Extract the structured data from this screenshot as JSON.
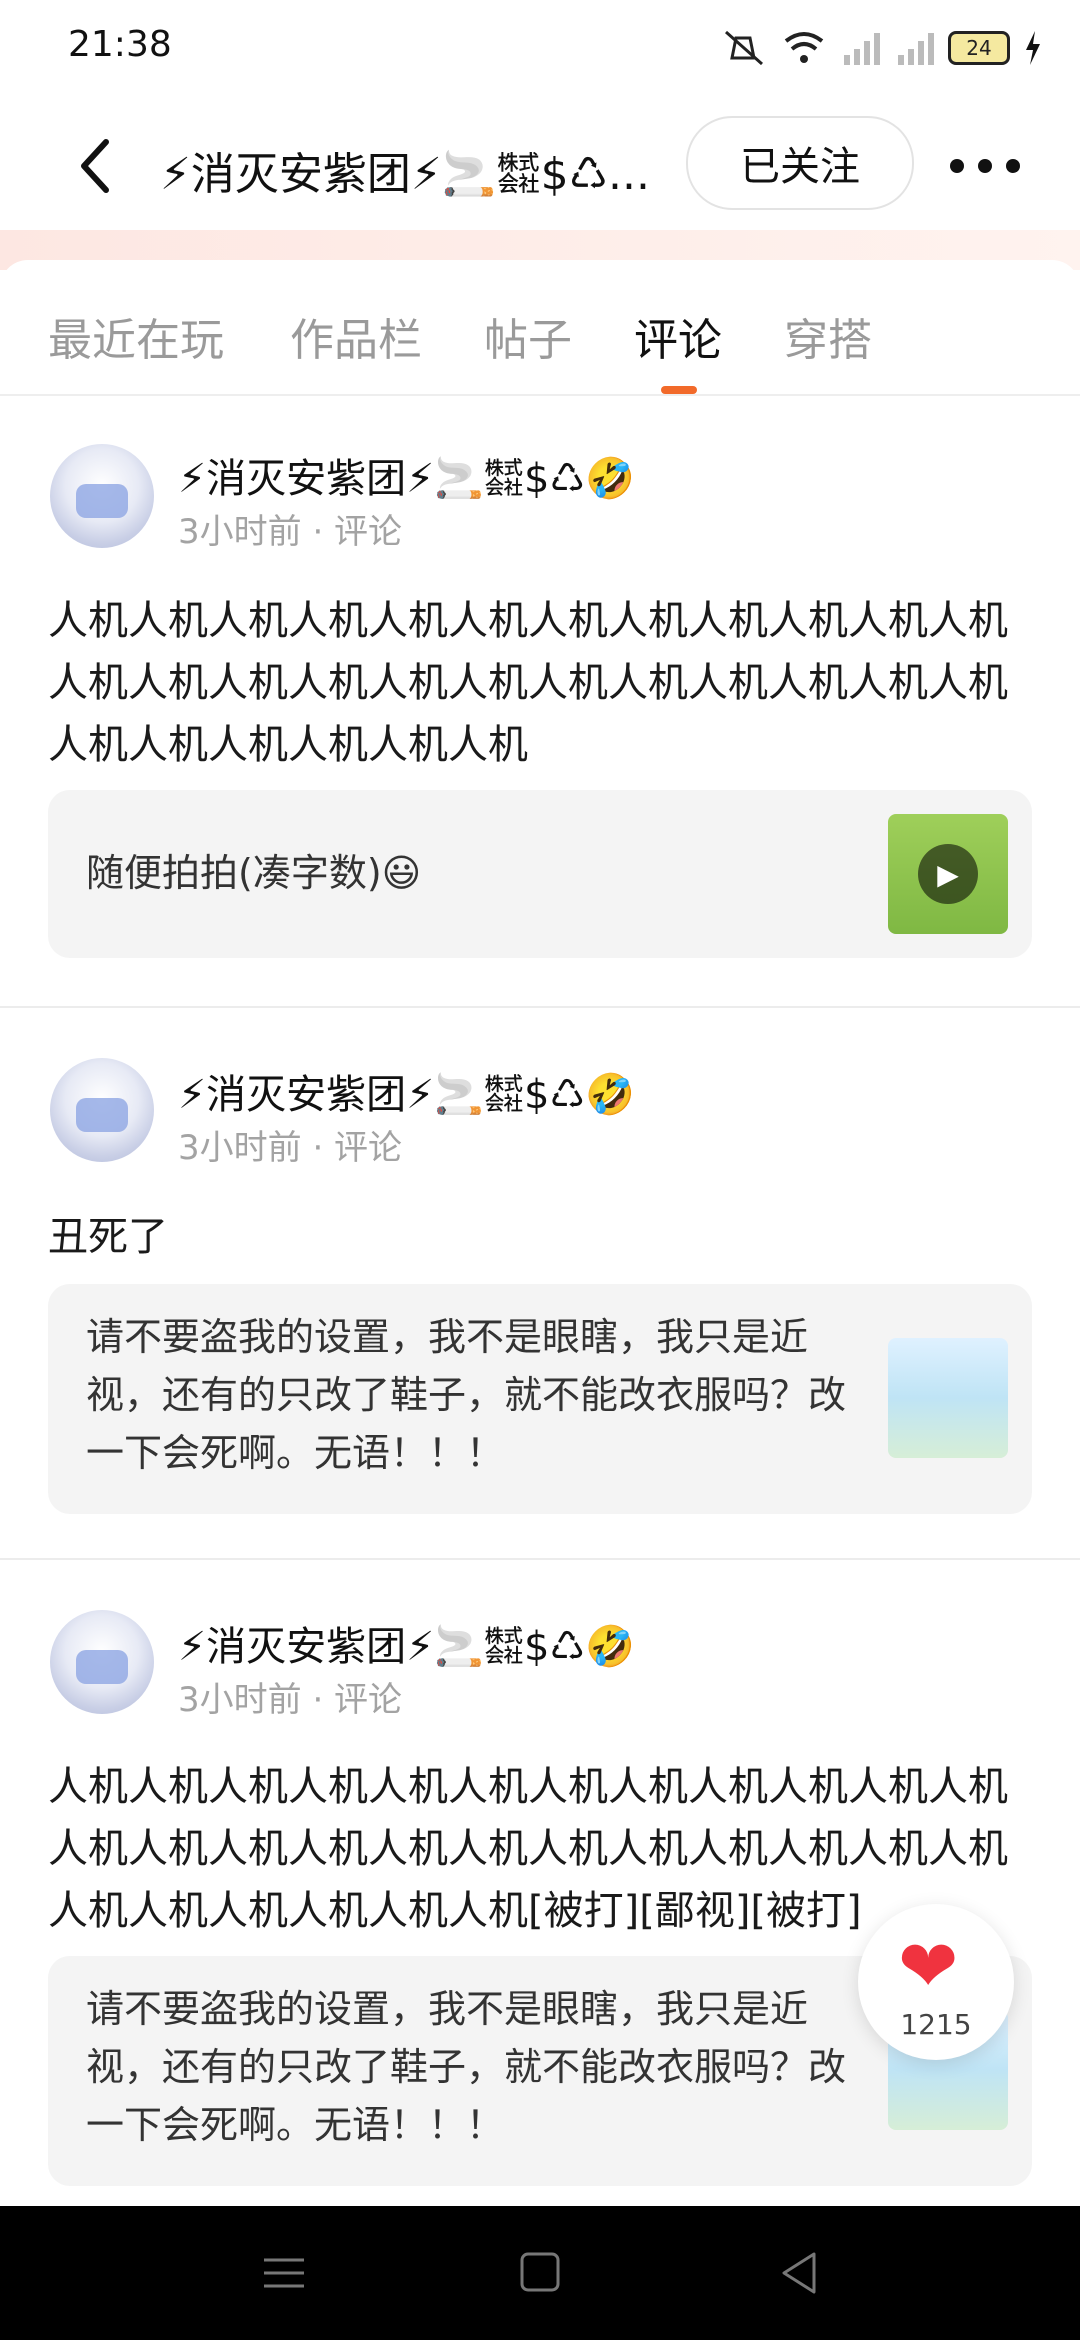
{
  "status": {
    "time": "21:38",
    "battery": "24"
  },
  "header": {
    "title": "⚡消灭安紫团⚡🚬㍿$♺...",
    "follow_label": "已关注"
  },
  "tabs": [
    {
      "label": "最近在玩"
    },
    {
      "label": "作品栏"
    },
    {
      "label": "帖子"
    },
    {
      "label": "评论"
    },
    {
      "label": "穿搭"
    }
  ],
  "posts": [
    {
      "username": "⚡消灭安紫团⚡🚬㍿$♺🤣",
      "meta": "3小时前 · 评论",
      "text": "人机人机人机人机人机人机人机人机人机人机人机人机人机人机人机人机人机人机人机人机人机人机人机人机人机人机人机人机人机人机",
      "quote": "随便拍拍(凑字数)😃"
    },
    {
      "username": "⚡消灭安紫团⚡🚬㍿$♺🤣",
      "meta": "3小时前 · 评论",
      "text": "丑死了",
      "quote": "请不要盗我的设置，我不是眼瞎，我只是近视，还有的只改了鞋子，就不能改衣服吗？改一下会死啊。无语！！！"
    },
    {
      "username": "⚡消灭安紫团⚡🚬㍿$♺🤣",
      "meta": "3小时前 · 评论",
      "text": "人机人机人机人机人机人机人机人机人机人机人机人机人机人机人机人机人机人机人机人机人机人机人机人机人机人机人机人机人机人机[被打][鄙视][被打]",
      "quote": "请不要盗我的设置，我不是眼瞎，我只是近视，还有的只改了鞋子，就不能改衣服吗？改一下会死啊。无语！！！"
    }
  ],
  "like": {
    "count": "1215"
  },
  "colors": {
    "accent": "#f26a2a",
    "heart": "#f0333f"
  }
}
